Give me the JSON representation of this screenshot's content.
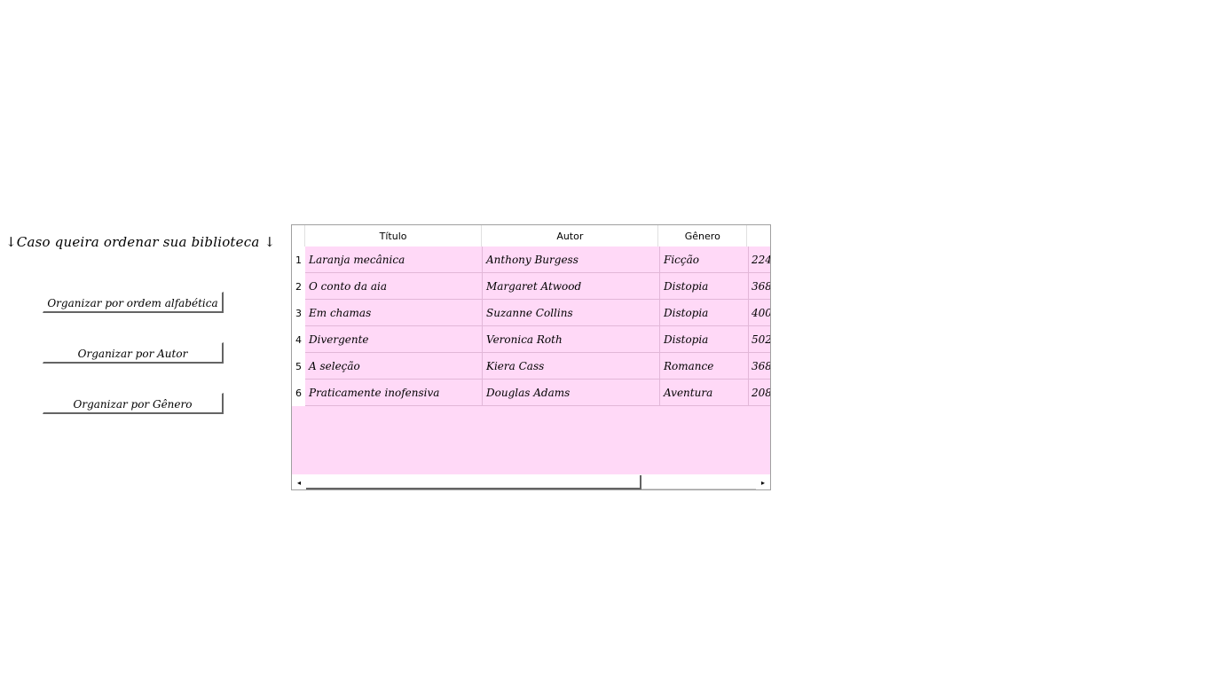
{
  "hint": {
    "text": "↓Caso queira ordenar sua biblioteca ↓"
  },
  "buttons": {
    "alphabetical": "Organizar por ordem alfabética",
    "author": "Organizar por Autor",
    "genre": "Organizar por Gênero"
  },
  "table": {
    "columns": [
      "Título",
      "Autor",
      "Gênero",
      ""
    ],
    "rows": [
      {
        "num": "1",
        "titulo": "Laranja mecânica",
        "autor": " Anthony Burgess",
        "genero": "Ficção",
        "paginas": "224"
      },
      {
        "num": "2",
        "titulo": "O conto da aia",
        "autor": " Margaret Atwood",
        "genero": "Distopia",
        "paginas": "368"
      },
      {
        "num": "3",
        "titulo": "Em chamas",
        "autor": " Suzanne Collins",
        "genero": "Distopia",
        "paginas": "400"
      },
      {
        "num": "4",
        "titulo": "Divergente",
        "autor": " Veronica Roth",
        "genero": "Distopia",
        "paginas": "502"
      },
      {
        "num": "5",
        "titulo": "A seleção",
        "autor": "Kiera Cass",
        "genero": "Romance",
        "paginas": "368"
      },
      {
        "num": "6",
        "titulo": "Praticamente inofensiva",
        "autor": "Douglas Adams",
        "genero": "Aventura",
        "paginas": "208"
      }
    ]
  },
  "scrollbar": {
    "left_arrow": "◂",
    "right_arrow": "▸"
  },
  "colors": {
    "grid_background": "#ffd9f7",
    "cell_border": "#e2b7d8"
  }
}
